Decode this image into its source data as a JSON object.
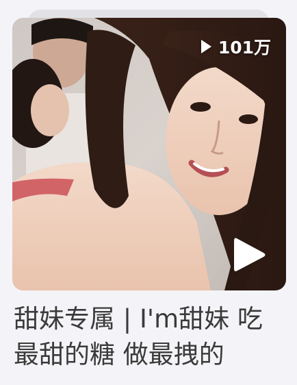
{
  "video_card": {
    "view_count": "101万",
    "title": "甜妹专属 | I'm甜妹 吃最甜的糖 做最拽的",
    "thumbnail_alt": "video thumbnail",
    "overlay_icon": "play-icon"
  },
  "colors": {
    "page_background": "#f4f4f8",
    "title_text": "#3a3a3a",
    "overlay_text": "#ffffff"
  }
}
